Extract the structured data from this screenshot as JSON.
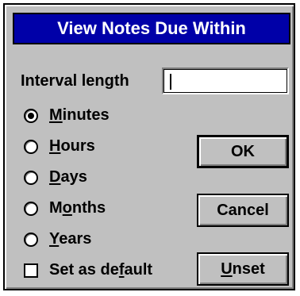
{
  "dialog": {
    "title": "View Notes Due Within"
  },
  "interval": {
    "label_pre": "Interval length",
    "value": ""
  },
  "units": [
    {
      "pre": "",
      "mnemonic": "M",
      "post": "inutes",
      "selected": true
    },
    {
      "pre": "",
      "mnemonic": "H",
      "post": "ours",
      "selected": false
    },
    {
      "pre": "",
      "mnemonic": "D",
      "post": "ays",
      "selected": false
    },
    {
      "pre": "M",
      "mnemonic": "o",
      "post": "nths",
      "selected": false
    },
    {
      "pre": "",
      "mnemonic": "Y",
      "post": "ears",
      "selected": false
    }
  ],
  "default_checkbox": {
    "pre": "Set as de",
    "mnemonic": "f",
    "post": "ault",
    "checked": false
  },
  "buttons": {
    "ok": "OK",
    "cancel": "Cancel",
    "unset_mnemonic": "U",
    "unset_post": "nset"
  }
}
